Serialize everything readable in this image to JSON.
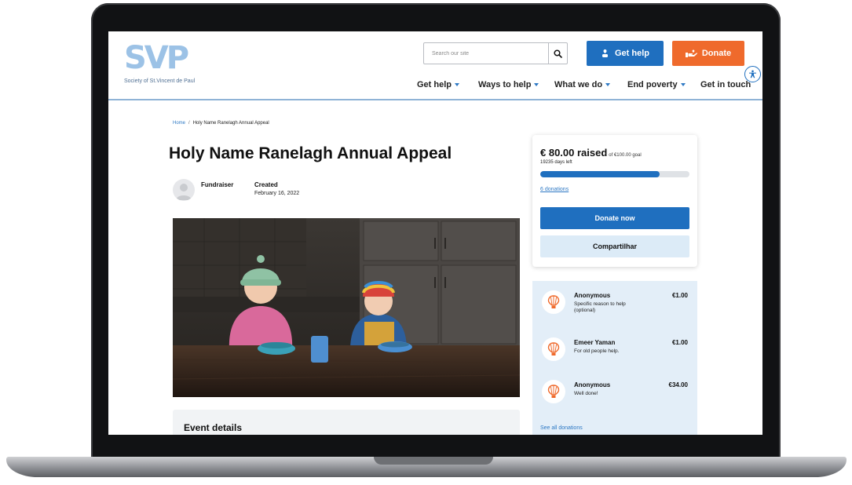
{
  "header": {
    "logo_mark": "SVP",
    "logo_text": "Society of St.Vincent de Paul",
    "search_placeholder": "Search our site",
    "get_help_button": "Get help",
    "donate_button": "Donate"
  },
  "nav": {
    "items": [
      {
        "label": "Get help",
        "caret": true
      },
      {
        "label": "Ways to help",
        "caret": true
      },
      {
        "label": "What we do",
        "caret": true
      },
      {
        "label": "End poverty",
        "caret": true
      },
      {
        "label": "Get in touch",
        "caret": false
      }
    ]
  },
  "breadcrumb": {
    "home": "Home",
    "separator": "/",
    "current": "Holy Name Ranelagh Annual Appeal"
  },
  "page": {
    "title": "Holy Name Ranelagh Annual Appeal",
    "fundraiser_label": "Fundraiser",
    "created_label": "Created",
    "created_date": "February 16, 2022",
    "event_details_title": "Event details"
  },
  "donation_card": {
    "raised_amount": "€ 80.00 raised",
    "goal_text": "of €100.00 goal",
    "days_left": "19235 days left",
    "progress_fraction": 0.8,
    "donations_link": "6 donations",
    "donate_now_button": "Donate now",
    "share_button": "Compartilhar"
  },
  "donations": {
    "items": [
      {
        "name": "Anonymous",
        "message": "Specific reason to help (optional)",
        "amount": "€1.00"
      },
      {
        "name": "Emeer Yaman",
        "message": "For old people help.",
        "amount": "€1.00"
      },
      {
        "name": "Anonymous",
        "message": "Well done!",
        "amount": "€34.00"
      }
    ],
    "see_all": "See all donations"
  },
  "colors": {
    "primary_blue": "#1f6fbf",
    "donate_orange": "#ef6a2c",
    "logo_blue": "#9cc2e6",
    "panel_blue": "#e3eef8"
  }
}
